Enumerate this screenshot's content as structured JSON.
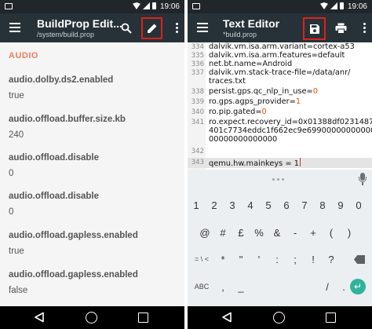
{
  "status_bar": {
    "time": "19:06"
  },
  "left": {
    "title": "BuildProp Edit...",
    "subtitle": "/system/build.prop",
    "section": "AUDIO",
    "props": [
      {
        "key": "audio.dolby.ds2.enabled",
        "value": "true"
      },
      {
        "key": "audio.offload.buffer.size.kb",
        "value": "240"
      },
      {
        "key": "audio.offload.disable",
        "value": "0"
      },
      {
        "key": "audio.offload.disable",
        "value": "0"
      },
      {
        "key": "audio.offload.gapless.enabled",
        "value": "true"
      },
      {
        "key": "audio.offload.gapless.enabled",
        "value": "false"
      }
    ],
    "icons": {
      "menu": "hamburger-menu-icon",
      "search": "search-icon",
      "edit": "pencil-edit-icon",
      "more": "overflow-menu-icon"
    }
  },
  "right": {
    "title": "Text Editor",
    "subtitle": "*build.prop",
    "lines": [
      {
        "num": "334",
        "text": "dalvik.vm.isa.arm.variant=cortex-a53"
      },
      {
        "num": "335",
        "text": "dalvik.vm.isa.arm.features=default"
      },
      {
        "num": "336",
        "text": "net.bt.name=Android"
      },
      {
        "num": "337",
        "text": "dalvik.vm.stack-trace-file=/data/anr/"
      },
      {
        "num": "",
        "text": "traces.txt"
      },
      {
        "num": "338",
        "text": "persist.gps.qc_nlp_in_use=",
        "val": "0"
      },
      {
        "num": "339",
        "text": "ro.gps.agps_provider=",
        "val": "1"
      },
      {
        "num": "340",
        "text": "ro.pip.gated=",
        "val": "0"
      },
      {
        "num": "341",
        "text": "ro.expect.recovery_id=0x01388df02314878"
      },
      {
        "num": "",
        "text": "401c7734eddc1f662ec9e69900000000000"
      },
      {
        "num": "",
        "text": "00000000000000"
      },
      {
        "num": "342",
        "text": ""
      },
      {
        "num": "343",
        "text": "qemu.hw.mainkeys = 1"
      }
    ],
    "icons": {
      "menu": "hamburger-menu-icon",
      "save": "save-floppy-icon",
      "print": "print-icon",
      "more": "overflow-menu-icon"
    },
    "keyboard": {
      "row_numbers": [
        "1",
        "2",
        "3",
        "4",
        "5",
        "6",
        "7",
        "8",
        "9",
        "0"
      ],
      "row_symbols1": [
        "@",
        "#",
        "£",
        "%",
        "&",
        "-",
        "+",
        "(",
        ")"
      ],
      "row_symbols2_left": "= \\ <",
      "row_symbols2": [
        "*",
        "\"",
        "'",
        ":",
        ";",
        "!",
        "?"
      ],
      "row_bottom_left": "ABC",
      "row_bottom_keys": [
        ",",
        "_",
        "/",
        "."
      ]
    }
  },
  "colors": {
    "toolbar": "#263238",
    "accent": "#ef7e5e",
    "highlight": "#e0201b",
    "enter": "#2fb39a",
    "number": "#e65100"
  }
}
